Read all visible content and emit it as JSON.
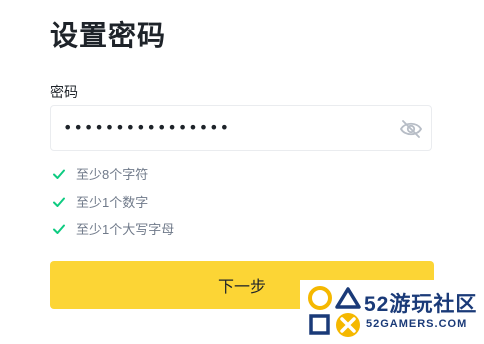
{
  "page": {
    "title": "设置密码"
  },
  "password": {
    "label": "密码",
    "masked_value": "••••••••••••••••",
    "visibility_icon": "eye-slash-icon"
  },
  "rules": [
    {
      "text": "至少8个字符",
      "met": true
    },
    {
      "text": "至少1个数字",
      "met": true
    },
    {
      "text": "至少1个大写字母",
      "met": true
    }
  ],
  "next_button": {
    "label": "下一步"
  },
  "watermark": {
    "name": "52游玩社区",
    "domain": "52GAMERS.COM"
  },
  "colors": {
    "primary_button": "#fcd535",
    "check_green": "#0ecb81",
    "text_primary": "#1e2329",
    "text_secondary": "#707a8a",
    "border": "#eaecef"
  }
}
